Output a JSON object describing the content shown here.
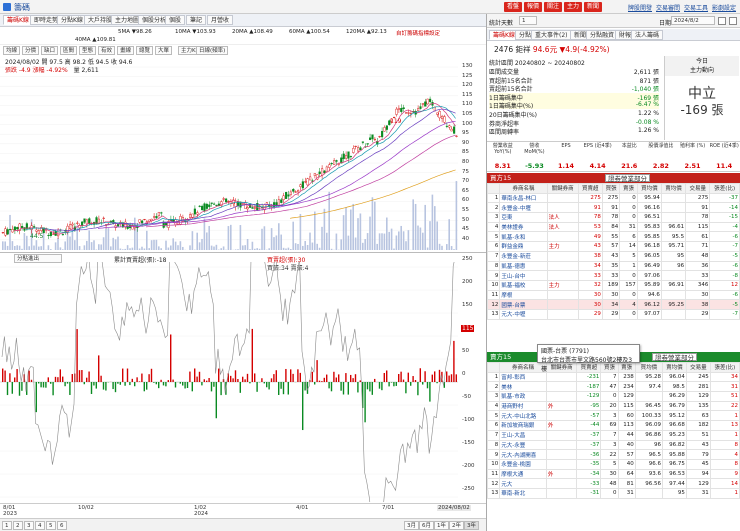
{
  "window": {
    "title": "籌碼"
  },
  "topbar": {
    "buttons": [
      "看盤",
      "報價",
      "關注",
      "主力",
      "新聞"
    ],
    "links": [
      "牌股開發",
      "交易審問",
      "交易工具",
      "影劇設定"
    ]
  },
  "left_tabs": [
    "籌碼K線",
    "即時走勢",
    "分點K線",
    "大戶持股",
    "主力地圖",
    "個股分析",
    "個股",
    "筆記",
    "月營收"
  ],
  "ma_legend": [
    {
      "label": "5MA ▼98.26",
      "color": "#d4377a"
    },
    {
      "label": "10MA ▼103.93",
      "color": "#1a9bb0"
    },
    {
      "label": "20MA ▲108.49",
      "color": "#6a3fc0"
    },
    {
      "label": "60MA ▲100.54",
      "color": "#c03fa0"
    },
    {
      "label": "120MA ▲92.13",
      "color": "#e0a020"
    },
    {
      "label": "40MA ▲109.81",
      "color": "#9b3ac8"
    }
  ],
  "chip_badge": "自訂籌碼指標設定",
  "toolbar": [
    "均線",
    "分價",
    "缺口",
    "區間",
    "型態",
    "有效",
    "畫線",
    "總覽",
    "大單",
    "主力K線",
    "日線(頻率)"
  ],
  "quote": {
    "line": "2024/08/02  開 97.5  高 98.2  低 94.5  收 94.6",
    "change": "張跌 -4.9  漲幅 -4.92%",
    "volume": "量 2,611"
  },
  "price_axis": [
    "130",
    "125",
    "120",
    "115",
    "110",
    "105",
    "100",
    "95",
    "90",
    "85",
    "80",
    "75",
    "70",
    "65",
    "60",
    "55",
    "50",
    "45",
    "40"
  ],
  "price_marks": {
    "peak": "119",
    "low": "44.5"
  },
  "sub_selector": "分點進出",
  "sub_legend": [
    "累計買賣超(張):-18",
    "買賣超(張):30",
    "買張:34  賣張:4"
  ],
  "sub_axis": [
    "250",
    "200",
    "150",
    "100",
    "50",
    "0",
    "-50",
    "-100",
    "-150",
    "-200",
    "-250"
  ],
  "sub_marker": "115",
  "x_dates": [
    "8/01",
    "10/02",
    "1/02",
    "4/01",
    "7/01",
    "2024/08/02"
  ],
  "x_years": {
    "a": "2023",
    "b": "2024"
  },
  "pager": [
    "1",
    "2",
    "3",
    "4",
    "5",
    "6"
  ],
  "range_buttons": [
    "3月",
    "6月",
    "1年",
    "2年",
    "3年"
  ],
  "right": {
    "period_label": "統計天數",
    "period_value": "1",
    "date_label": "日期",
    "date_value": "2024/8/2",
    "tabs": [
      "籌碼K線",
      "分點",
      "重大事件(2)",
      "新聞",
      "分點融資",
      "財報",
      "法人籌碼"
    ],
    "stock_code": "2476",
    "stock_name": "鉅祥",
    "stock_price": "94.6元",
    "stock_change": "▼4.9(-4.92%)",
    "stats_header": "統計區間  20240802 ~ 20240802",
    "stats": [
      {
        "k": "區間成交量",
        "v": "2,611 張"
      },
      {
        "k": "買超前15名合計",
        "v": "871 張"
      },
      {
        "k": "賣超前15名合計",
        "v": "-1,040 張"
      },
      {
        "k": "1日籌碼集中",
        "v": "-169 張"
      },
      {
        "k": "1日籌碼集中(%)",
        "v": "-6.47 %"
      },
      {
        "k": "20日籌碼集中(%)",
        "v": "1.22 %"
      },
      {
        "k": "券商淨超率",
        "v": "-0.08 %"
      },
      {
        "k": "區間周轉率",
        "v": "1.26 %"
      }
    ],
    "today_label": "今日",
    "main_force_label": "主力動向",
    "main_force_state": "中立",
    "main_force_value": "-169 張",
    "fund_headers": [
      "營業收益 YoY(%)",
      "營收 MoM(%)",
      "EPS",
      "EPS (近4季)",
      "本益比",
      "股價淨值比",
      "殖利率 (%)",
      "ROE (近4季)"
    ],
    "fund_values": [
      "8.31",
      "-5.93",
      "1.14",
      "4.14",
      "21.6",
      "2.82",
      "2.51",
      "11.4"
    ]
  },
  "buy_section": {
    "title": "買方15",
    "filter": "證券營業部分",
    "headers": [
      "",
      "券商名稱",
      "關鍵券商",
      "買賣超",
      "買張",
      "賣張",
      "買均價",
      "賣均價",
      "交易量",
      "張差(比)"
    ],
    "rows": [
      [
        "1",
        "華南永昌-林口",
        "",
        "275",
        "275",
        "0",
        "95.94",
        "",
        "275",
        "-37"
      ],
      [
        "2",
        "永豐金-中壢",
        "",
        "91",
        "91",
        "0",
        "96.16",
        "",
        "91",
        "-14"
      ],
      [
        "3",
        "亞東",
        "法人",
        "78",
        "78",
        "0",
        "96.51",
        "",
        "78",
        "-15"
      ],
      [
        "4",
        "美林證券",
        "法人",
        "53",
        "84",
        "31",
        "95.83",
        "96.61",
        "115",
        "-4"
      ],
      [
        "5",
        "凱基-永和",
        "",
        "49",
        "55",
        "6",
        "95.85",
        "95.5",
        "61",
        "-6"
      ],
      [
        "6",
        "群益金鼎",
        "主力",
        "43",
        "57",
        "14",
        "96.18",
        "95.71",
        "71",
        "-7"
      ],
      [
        "7",
        "永豐金-新莊",
        "",
        "38",
        "43",
        "5",
        "96.05",
        "95",
        "48",
        "-5"
      ],
      [
        "8",
        "凱基-德惠",
        "",
        "34",
        "35",
        "1",
        "96.49",
        "96",
        "36",
        "-6"
      ],
      [
        "9",
        "王山-台中",
        "",
        "33",
        "33",
        "0",
        "97.06",
        "",
        "33",
        "-8"
      ],
      [
        "10",
        "凱基-福校",
        "主力",
        "32",
        "189",
        "157",
        "95.89",
        "96.91",
        "346",
        "12"
      ],
      [
        "11",
        "摩根",
        "",
        "30",
        "30",
        "0",
        "94.6",
        "",
        "30",
        "-6"
      ],
      [
        "12",
        "國票-台票",
        "",
        "30",
        "34",
        "4",
        "96.12",
        "95.25",
        "38",
        "-5"
      ],
      [
        "13",
        "元大-中壢",
        "",
        "29",
        "29",
        "0",
        "97.07",
        "",
        "29",
        "-7"
      ]
    ]
  },
  "tooltip": {
    "title": "國票-台票 (7791)",
    "body": "台北市台票市里文路560號2樓及3樓"
  },
  "sell_section": {
    "title": "賣方15",
    "filter": "證券營業部分",
    "headers": [
      "",
      "券商名稱",
      "關鍵券商",
      "買賣超",
      "買張",
      "賣張",
      "買均價",
      "賣均價",
      "交易量",
      "張差(比)"
    ],
    "rows": [
      [
        "1",
        "富邦-彰西",
        "",
        "-231",
        "7",
        "238",
        "95.28",
        "96.04",
        "245",
        "34"
      ],
      [
        "2",
        "美林",
        "",
        "-187",
        "47",
        "234",
        "97.4",
        "98.5",
        "281",
        "31"
      ],
      [
        "3",
        "凱基-市政",
        "",
        "-129",
        "0",
        "129",
        "",
        "96.29",
        "129",
        "51"
      ],
      [
        "4",
        "港商野村",
        "外",
        "-95",
        "20",
        "115",
        "96.45",
        "96.79",
        "135",
        "22"
      ],
      [
        "5",
        "元大-中山北路",
        "",
        "-57",
        "3",
        "60",
        "100.33",
        "95.12",
        "63",
        "1"
      ],
      [
        "6",
        "新加坡商瑞銀",
        "外",
        "-44",
        "69",
        "113",
        "96.09",
        "96.68",
        "182",
        "13"
      ],
      [
        "7",
        "王山-大昌",
        "",
        "-37",
        "7",
        "44",
        "96.86",
        "95.23",
        "51",
        "1"
      ],
      [
        "8",
        "元大-永豐",
        "",
        "-37",
        "3",
        "40",
        "96",
        "96.82",
        "43",
        "8"
      ],
      [
        "9",
        "元大-內湖開喜",
        "",
        "-36",
        "22",
        "57",
        "96.5",
        "95.88",
        "79",
        "4"
      ],
      [
        "10",
        "永豐金-桃園",
        "",
        "-35",
        "5",
        "40",
        "96.6",
        "96.75",
        "45",
        "8"
      ],
      [
        "11",
        "摩根大通",
        "外",
        "-34",
        "30",
        "64",
        "93.6",
        "96.53",
        "94",
        "9"
      ],
      [
        "12",
        "元大",
        "",
        "-33",
        "48",
        "81",
        "96.56",
        "97.44",
        "129",
        "14"
      ],
      [
        "13",
        "華南-新北",
        "",
        "-31",
        "0",
        "31",
        "",
        "95",
        "31",
        "1"
      ]
    ]
  }
}
